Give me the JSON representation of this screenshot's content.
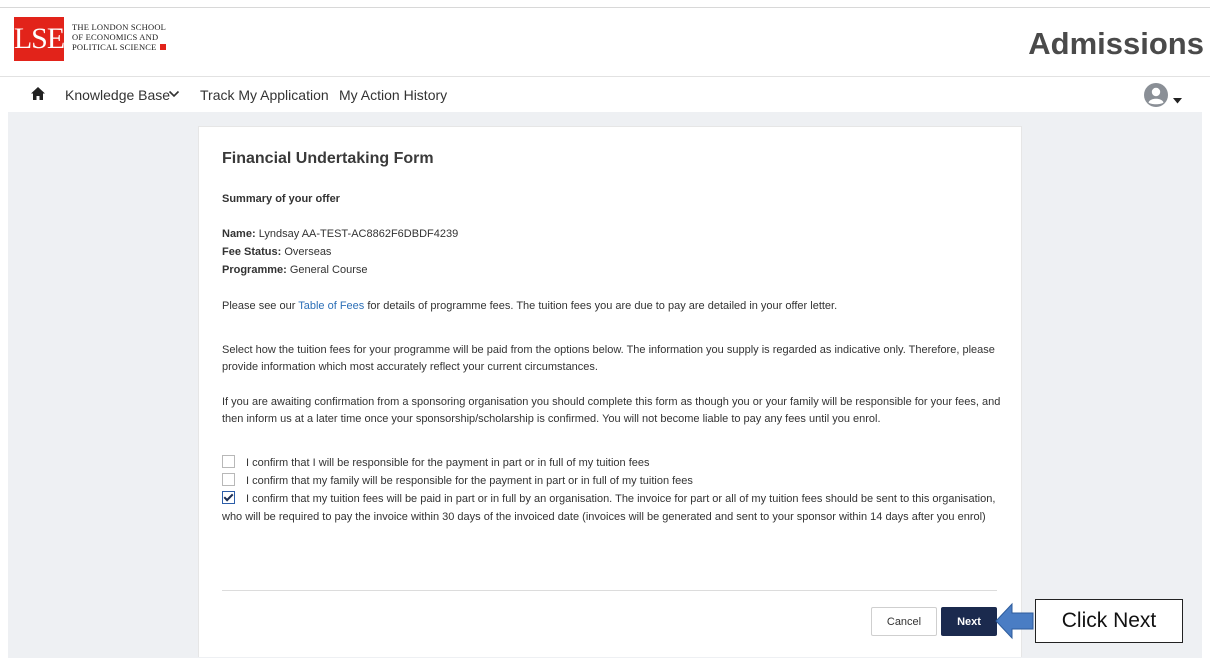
{
  "header": {
    "logo_mark": "LSE",
    "logo_line1": "THE LONDON SCHOOL",
    "logo_line2": "OF ECONOMICS AND",
    "logo_line3": "POLITICAL SCIENCE",
    "app_title": "Admissions"
  },
  "nav": {
    "home_icon": "home-icon",
    "knowledge_base": "Knowledge Base",
    "track_application": "Track My Application",
    "action_history": "My Action History",
    "avatar_icon": "user-avatar-icon"
  },
  "form": {
    "title": "Financial Undertaking Form",
    "summary_heading": "Summary of your offer",
    "name_label": "Name:",
    "name_value": "Lyndsay AA-TEST-AC8862F6DBDF4239",
    "fee_status_label": "Fee Status:",
    "fee_status_value": "Overseas",
    "programme_label": "Programme:",
    "programme_value": "General Course",
    "fees_text_before": "Please see our ",
    "fees_link": "Table of Fees",
    "fees_text_after": " for details of programme fees. The tuition fees you are due to pay are detailed in your offer letter.",
    "select_text": "Select how the tuition fees for your programme will be paid from the options below. The information you supply is regarded as indicative only. Therefore, please provide information which most accurately reflect your current circumstances.",
    "awaiting_text": "If you are awaiting confirmation from a sponsoring organisation you should complete this form as though you or your family will be responsible for your fees, and then inform us at a later time once your sponsorship/scholarship is confirmed. You will not become liable to pay any fees until you enrol.",
    "options": [
      {
        "label": "I confirm that I will be responsible for the payment in part or in full of my tuition fees",
        "checked": false
      },
      {
        "label": "I confirm that my family will be responsible for the payment in part or in full of my tuition fees",
        "checked": false
      },
      {
        "label": "I confirm that my tuition fees will be paid in part or in full by an organisation. The invoice for part or all of my tuition fees should be sent to this organisation, who will be required to pay the invoice within 30 days of the invoiced date (invoices will be generated and sent to your sponsor within 14 days after you enrol)",
        "checked": true
      }
    ],
    "cancel_label": "Cancel",
    "next_label": "Next"
  },
  "annotation": {
    "callout_text": "Click Next",
    "arrow_color": "#4a7dc4"
  },
  "colors": {
    "brand_red": "#e2231a",
    "primary_button": "#1b2a4e",
    "link": "#2c6fb7"
  }
}
